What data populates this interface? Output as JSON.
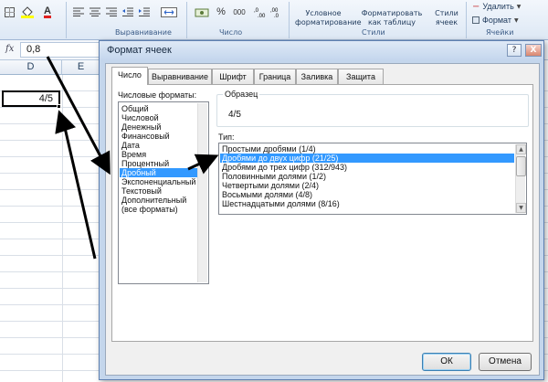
{
  "ribbon": {
    "font_group_label": "",
    "alignment_group_label": "Выравнивание",
    "number_group_label": "Число",
    "styles_group_label": "Стили",
    "cells_group_label": "Ячейки",
    "conditional_formatting": "Условное форматирование",
    "format_as_table": "Форматировать как таблицу",
    "cell_styles": "Стили ячеек",
    "delete_button": "Удалить",
    "format_button": "Формат",
    "percent_symbol": "%",
    "comma_symbol": "000",
    "underline_symbol": "A"
  },
  "formula_bar": {
    "fx_label": "fx",
    "value": "0,8"
  },
  "sheet": {
    "columns": [
      "D",
      "E"
    ],
    "active_cell_value": "4/5"
  },
  "dialog": {
    "title": "Формат ячеек",
    "tabs": [
      "Число",
      "Выравнивание",
      "Шрифт",
      "Граница",
      "Заливка",
      "Защита"
    ],
    "active_tab": "Число",
    "number_formats_label": "Числовые форматы:",
    "number_formats": [
      "Общий",
      "Числовой",
      "Денежный",
      "Финансовый",
      "Дата",
      "Время",
      "Процентный",
      "Дробный",
      "Экспоненциальный",
      "Текстовый",
      "Дополнительный",
      "(все форматы)"
    ],
    "selected_format": "Дробный",
    "sample_label": "Образец",
    "sample_value": "4/5",
    "type_label": "Тип:",
    "types": [
      "Простыми дробями (1/4)",
      "Дробями до двух цифр (21/25)",
      "Дробями до трех цифр (312/943)",
      "Половинными долями (1/2)",
      "Четвертыми долями (2/4)",
      "Восьмыми долями (4/8)",
      "Шестнадцатыми долями (8/16)"
    ],
    "selected_type": "Дробями до двух цифр (21/25)",
    "ok_button": "ОК",
    "cancel_button": "Отмена",
    "help_symbol": "?",
    "close_symbol": "X"
  },
  "colors": {
    "selection": "#3399ff",
    "ribbon_bg": "#dde8f5",
    "dialog_frame": "#c4d6ec"
  }
}
